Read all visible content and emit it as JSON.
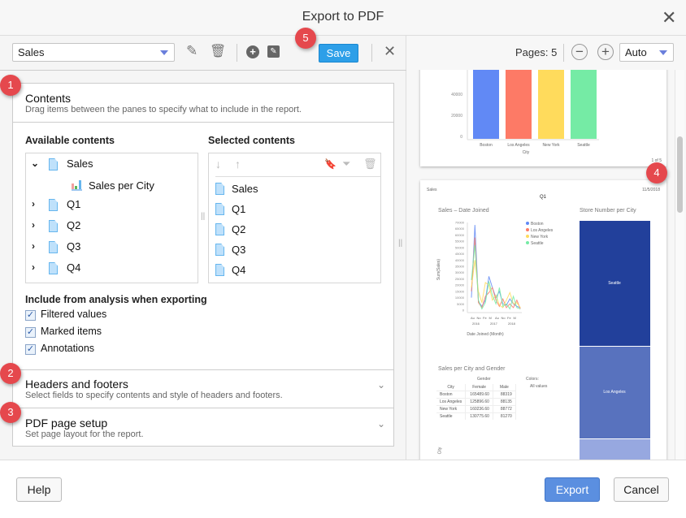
{
  "dialog": {
    "title": "Export to PDF",
    "close_icon": "close-icon"
  },
  "toolbar": {
    "preset_value": "Sales",
    "save_label": "Save"
  },
  "badges": [
    "1",
    "2",
    "3",
    "4",
    "5"
  ],
  "contents": {
    "title": "Contents",
    "subtitle": "Drag items between the panes to specify what to include in the report.",
    "available_label": "Available contents",
    "selected_label": "Selected contents",
    "available": [
      {
        "label": "Sales",
        "expanded": true,
        "children": [
          {
            "label": "Sales per City"
          }
        ]
      },
      {
        "label": "Q1",
        "expanded": false
      },
      {
        "label": "Q2",
        "expanded": false
      },
      {
        "label": "Q3",
        "expanded": false
      },
      {
        "label": "Q4",
        "expanded": false
      }
    ],
    "selected": [
      "Sales",
      "Q1",
      "Q2",
      "Q3",
      "Q4"
    ],
    "include_label": "Include from analysis when exporting",
    "include_options": [
      {
        "label": "Filtered values",
        "checked": true
      },
      {
        "label": "Marked items",
        "checked": true
      },
      {
        "label": "Annotations",
        "checked": true
      }
    ]
  },
  "headers_footers": {
    "title": "Headers and footers",
    "subtitle": "Select fields to specify contents and style of headers and footers."
  },
  "page_setup": {
    "title": "PDF page setup",
    "subtitle": "Set page layout for the report."
  },
  "preview": {
    "pages_label": "Pages: 5",
    "zoom_value": "Auto",
    "page1": {
      "yticks": [
        "40000",
        "20000",
        "0"
      ],
      "categories": [
        "Boston",
        "Los Angeles",
        "New York",
        "Seattle"
      ],
      "colors": [
        "#6189f5",
        "#fd7a66",
        "#ffdb5c",
        "#75eba5"
      ],
      "xlabel": "City",
      "page_no": "1 of 5"
    },
    "page2": {
      "header_left": "Sales",
      "header_right": "11/5/2018",
      "title": "Q1",
      "line_title": "Sales – Date Joined",
      "legend": [
        "Boston",
        "Los Angeles",
        "New York",
        "Seattle"
      ],
      "yticks": [
        "70000",
        "65000",
        "60000",
        "55000",
        "50000",
        "45000",
        "40000",
        "35000",
        "30000",
        "25000",
        "20000",
        "15000",
        "10000",
        "5000",
        "0"
      ],
      "ylabel": "Sum(Sales)",
      "xticks": [
        "Au",
        "No",
        "Fe",
        "M",
        "Au",
        "No",
        "Fe",
        "M"
      ],
      "years": [
        "2016",
        "2017",
        "2018"
      ],
      "xlabel": "Date Joined (Month)",
      "series": [
        [
          10000,
          68000,
          7000,
          3000,
          8000,
          27000,
          18000,
          10000,
          15000,
          5000,
          4000,
          9000,
          5000,
          3000,
          2000
        ],
        [
          15000,
          58000,
          6000,
          2000,
          11000,
          14000,
          18000,
          8000,
          3000,
          9000,
          2000,
          5000,
          2000,
          8000,
          1000
        ],
        [
          18000,
          40000,
          15000,
          6000,
          22000,
          20000,
          8000,
          12000,
          4000,
          2000,
          8000,
          14000,
          5000,
          6000,
          2000
        ],
        [
          24000,
          52000,
          8000,
          1000,
          6000,
          23000,
          12000,
          5000,
          18000,
          3000,
          5000,
          1000,
          11000,
          2000,
          1000
        ]
      ],
      "treemap_title": "Store Number per City",
      "treemap_labels": [
        "Seattle",
        "Los Angeles"
      ],
      "table_title": "Sales per City and Gender",
      "gender_label": "Gender",
      "colors_label": "Colors:",
      "colors_value": "All values",
      "table_headers": [
        "City",
        "Female",
        "Male"
      ],
      "table_rows": [
        [
          "Boston",
          "165489.60",
          "88319"
        ],
        [
          "Los Angeles",
          "125896.60",
          "88135"
        ],
        [
          "New York",
          "160236.60",
          "88772"
        ],
        [
          "Seattle",
          "130775.60",
          "81270"
        ]
      ],
      "bottom_axis_label": "City"
    }
  },
  "footer": {
    "help": "Help",
    "export": "Export",
    "cancel": "Cancel"
  }
}
